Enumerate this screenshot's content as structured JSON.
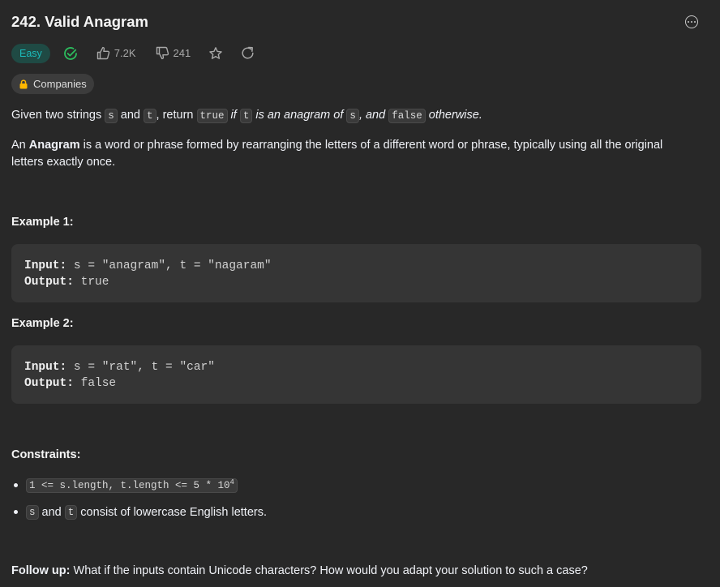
{
  "problem": {
    "title": "242. Valid Anagram",
    "difficulty": "Easy",
    "likes": "7.2K",
    "dislikes": "241",
    "companies_label": "Companies"
  },
  "description": {
    "p1": {
      "t1": "Given two strings ",
      "code_s": "s",
      "t2": " and ",
      "code_t": "t",
      "t3": ", return ",
      "code_true": "true",
      "t4": " if ",
      "code_t2": "t",
      "t5": " is an anagram of ",
      "code_s2": "s",
      "t6": ", and ",
      "code_false": "false",
      "t7": " otherwise."
    },
    "p2": {
      "t1": "An ",
      "bold": "Anagram",
      "t2": " is a word or phrase formed by rearranging the letters of a different word or phrase, typically using all the original letters exactly once."
    }
  },
  "examples": [
    {
      "heading": "Example 1:",
      "input_label": "Input:",
      "input_value": " s = \"anagram\", t = \"nagaram\"",
      "output_label": "Output:",
      "output_value": " true"
    },
    {
      "heading": "Example 2:",
      "input_label": "Input:",
      "input_value": " s = \"rat\", t = \"car\"",
      "output_label": "Output:",
      "output_value": " false"
    }
  ],
  "constraints": {
    "heading": "Constraints:",
    "c1": {
      "code": "1 <= s.length, t.length <= 5 * 10",
      "sup": "4"
    },
    "c2": {
      "code_s": "s",
      "t1": " and ",
      "code_t": "t",
      "t2": " consist of lowercase English letters."
    }
  },
  "follow_up": {
    "label": "Follow up:",
    "text": " What if the inputs contain Unicode characters? How would you adapt your solution to such a case?"
  },
  "colors": {
    "background": "#282828",
    "easy_badge_bg": "#1f4a44",
    "easy_badge_text": "#1cbaba",
    "solved_check": "#2cbb5d"
  }
}
